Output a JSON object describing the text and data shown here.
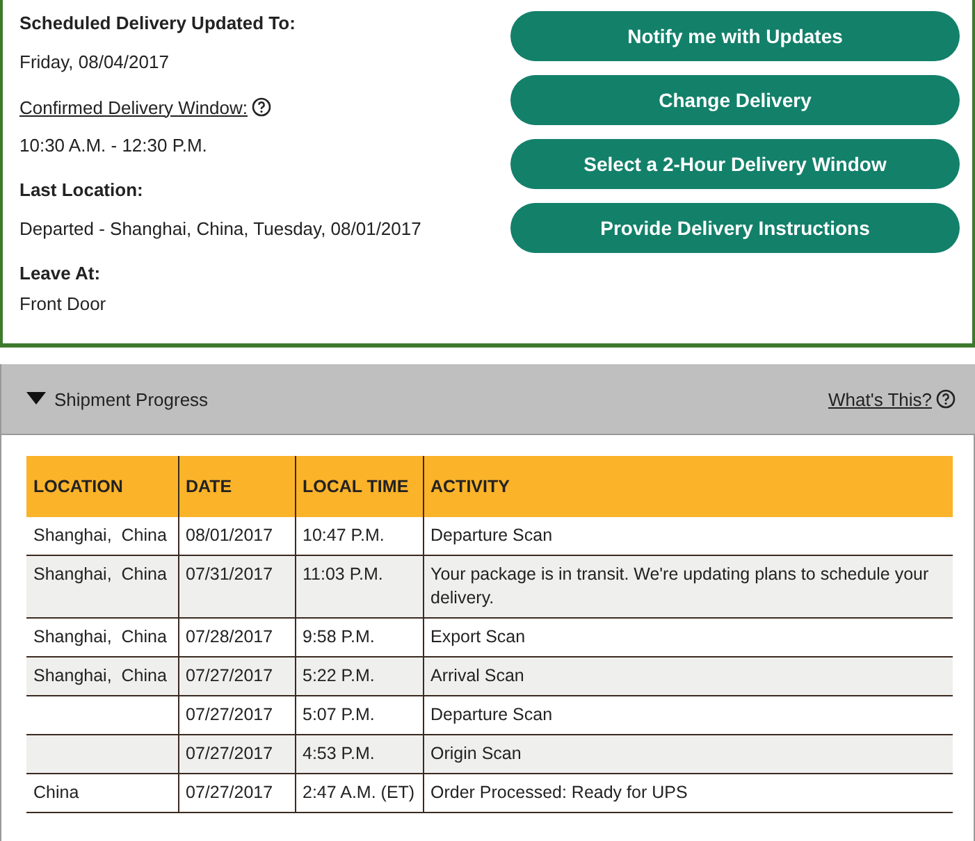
{
  "delivery": {
    "scheduled_label": "Scheduled Delivery Updated To:",
    "scheduled_value": "Friday, 08/04/2017",
    "window_label": "Confirmed Delivery Window:",
    "window_value": "10:30 A.M. - 12:30 P.M.",
    "last_location_label": "Last Location:",
    "last_location_value": "Departed - Shanghai, China, Tuesday, 08/01/2017",
    "leave_at_label": "Leave At:",
    "leave_at_value": "Front Door"
  },
  "actions": [
    "Notify me with Updates",
    "Change Delivery",
    "Select a 2-Hour Delivery Window",
    "Provide Delivery Instructions"
  ],
  "progress": {
    "title": "Shipment Progress",
    "expanded": true,
    "help_link": "What's This?"
  },
  "table": {
    "columns": [
      "LOCATION",
      "DATE",
      "LOCAL TIME",
      "ACTIVITY"
    ],
    "rows": [
      [
        "Shanghai,  China",
        "08/01/2017",
        "10:47 P.M.",
        "Departure Scan"
      ],
      [
        "Shanghai,  China",
        "07/31/2017",
        "11:03 P.M.",
        "Your package is in transit. We're updating plans to schedule your delivery."
      ],
      [
        "Shanghai,  China",
        "07/28/2017",
        "9:58 P.M.",
        "Export Scan"
      ],
      [
        "Shanghai,  China",
        "07/27/2017",
        "5:22 P.M.",
        "Arrival Scan"
      ],
      [
        "",
        "07/27/2017",
        "5:07 P.M.",
        "Departure Scan"
      ],
      [
        "",
        "07/27/2017",
        "4:53 P.M.",
        "Origin Scan"
      ],
      [
        "China",
        "07/27/2017",
        "2:47 A.M. (ET)",
        "Order Processed: Ready for UPS"
      ]
    ]
  }
}
